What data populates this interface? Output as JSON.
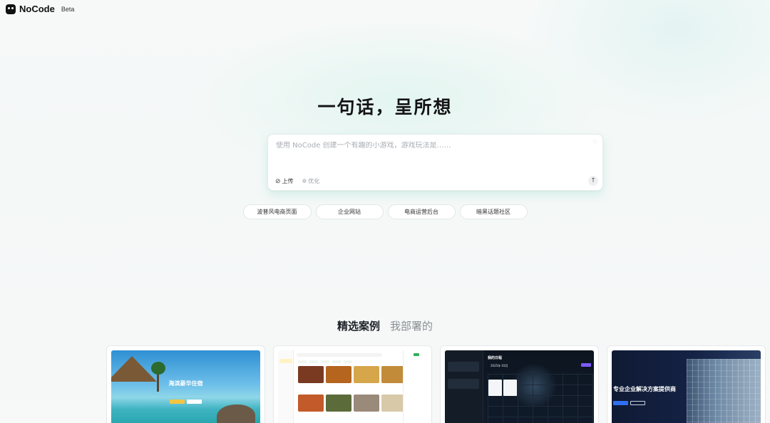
{
  "brand": {
    "name": "NoCode",
    "badge": "Beta"
  },
  "hero": {
    "title": "一句话，呈所想"
  },
  "prompt": {
    "placeholder": "使用 NoCode 创建一个有趣的小游戏，游戏玩法是……",
    "value": "",
    "upload_label": "上传",
    "optimize_label": "优化"
  },
  "suggestions": [
    "波普风电商页面",
    "企业网站",
    "电商运营后台",
    "暗黑话题社区"
  ],
  "tabs": {
    "featured": "精选案例",
    "mine": "我部署的"
  },
  "cases": [
    {
      "title": "海滨豪华住宿"
    },
    {
      "title": ""
    },
    {
      "title": "我的日程",
      "month": "2025年 03月"
    },
    {
      "title": "专业企业解决方案提供商"
    }
  ],
  "colors": {
    "accent_green": "#2fb15a",
    "accent_purple": "#7c5cff",
    "accent_blue": "#2f6ff0"
  }
}
